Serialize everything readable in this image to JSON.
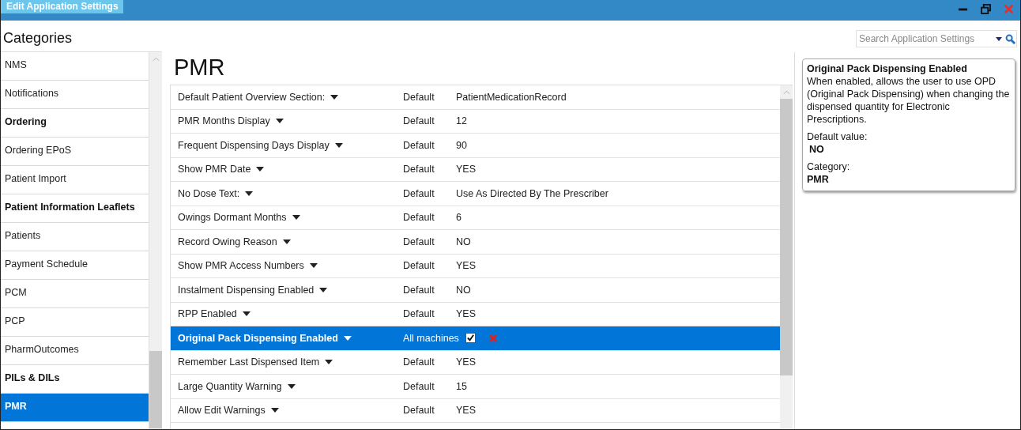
{
  "window": {
    "title": "Edit Application Settings"
  },
  "sidebar": {
    "title": "Categories",
    "items": [
      {
        "label": "NMS",
        "bold": false,
        "selected": false
      },
      {
        "label": "Notifications",
        "bold": false,
        "selected": false
      },
      {
        "label": "Ordering",
        "bold": true,
        "selected": false
      },
      {
        "label": "Ordering EPoS",
        "bold": false,
        "selected": false
      },
      {
        "label": "Patient Import",
        "bold": false,
        "selected": false
      },
      {
        "label": "Patient Information Leaflets",
        "bold": true,
        "selected": false
      },
      {
        "label": "Patients",
        "bold": false,
        "selected": false
      },
      {
        "label": "Payment Schedule",
        "bold": false,
        "selected": false
      },
      {
        "label": "PCM",
        "bold": false,
        "selected": false
      },
      {
        "label": "PCP",
        "bold": false,
        "selected": false
      },
      {
        "label": "PharmOutcomes",
        "bold": false,
        "selected": false
      },
      {
        "label": "PILs & DILs",
        "bold": true,
        "selected": false
      },
      {
        "label": "PMR",
        "bold": true,
        "selected": true
      }
    ]
  },
  "search": {
    "placeholder": "Search Application Settings"
  },
  "heading": "PMR",
  "settings": [
    {
      "kind": "default",
      "name": "Default Patient Overview Section:",
      "source": "Default",
      "value": "PatientMedicationRecord",
      "selected": false
    },
    {
      "kind": "default",
      "name": "PMR Months Display",
      "source": "Default",
      "value": "12",
      "selected": false
    },
    {
      "kind": "default",
      "name": "Frequent Dispensing Days Display",
      "source": "Default",
      "value": "90",
      "selected": false
    },
    {
      "kind": "default",
      "name": "Show PMR Date",
      "source": "Default",
      "value": "YES",
      "selected": false
    },
    {
      "kind": "default",
      "name": "No Dose Text:",
      "source": "Default",
      "value": "Use As Directed By The Prescriber",
      "selected": false
    },
    {
      "kind": "default",
      "name": "Owings Dormant Months",
      "source": "Default",
      "value": "6",
      "selected": false
    },
    {
      "kind": "default",
      "name": "Record Owing Reason",
      "source": "Default",
      "value": "NO",
      "selected": false
    },
    {
      "kind": "default",
      "name": "Show PMR Access Numbers",
      "source": "Default",
      "value": "YES",
      "selected": false
    },
    {
      "kind": "default",
      "name": "Instalment Dispensing Enabled",
      "source": "Default",
      "value": "NO",
      "selected": false
    },
    {
      "kind": "default",
      "name": "RPP Enabled",
      "source": "Default",
      "value": "YES",
      "selected": false
    },
    {
      "kind": "override",
      "name": "Original Pack Dispensing Enabled",
      "source": "All machines",
      "checked": true,
      "selected": true
    },
    {
      "kind": "default",
      "name": "Remember Last Dispensed Item",
      "source": "Default",
      "value": "YES",
      "selected": false
    },
    {
      "kind": "default",
      "name": "Large Quantity Warning",
      "source": "Default",
      "value": "15",
      "selected": false
    },
    {
      "kind": "default",
      "name": "Allow Edit Warnings",
      "source": "Default",
      "value": "YES",
      "selected": false
    }
  ],
  "info": {
    "title": "Original Pack Dispensing Enabled",
    "description": "When enabled, allows the user to use OPD (Original Pack Dispensing) when changing the dispensed quantity for Electronic Prescriptions.",
    "default_label": "Default value:",
    "default_value": "NO",
    "category_label": "Category:",
    "category_value": "PMR"
  }
}
